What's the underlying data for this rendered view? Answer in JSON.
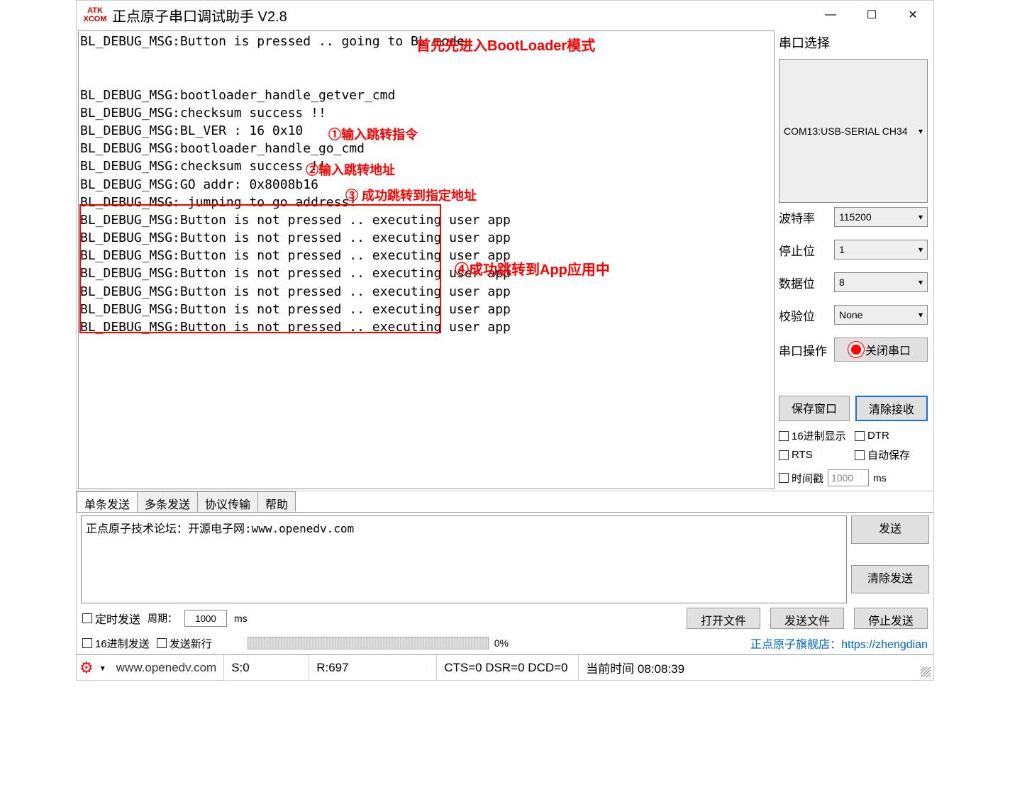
{
  "title": "正点原子串口调试助手 V2.8",
  "rx_lines": [
    "BL_DEBUG_MSG:Button is pressed .. going to BL mode",
    "",
    "",
    "BL_DEBUG_MSG:bootloader_handle_getver_cmd",
    "BL_DEBUG_MSG:checksum success !!",
    "BL_DEBUG_MSG:BL_VER : 16 0x10",
    "BL_DEBUG_MSG:bootloader_handle_go_cmd",
    "BL_DEBUG_MSG:checksum success !!",
    "BL_DEBUG_MSG:GO addr: 0x8008b16",
    "BL_DEBUG_MSG: jumping to go address!",
    "BL_DEBUG_MSG:Button is not pressed .. executing user app",
    "BL_DEBUG_MSG:Button is not pressed .. executing user app",
    "BL_DEBUG_MSG:Button is not pressed .. executing user app",
    "BL_DEBUG_MSG:Button is not pressed .. executing user app",
    "BL_DEBUG_MSG:Button is not pressed .. executing user app",
    "BL_DEBUG_MSG:Button is not pressed .. executing user app",
    "BL_DEBUG_MSG:Button is not pressed .. executing user app"
  ],
  "annotations": {
    "a1": "首先先进入BootLoader模式",
    "a2": "①输入跳转指令",
    "a3": "②输入跳转地址",
    "a4": "③ 成功跳转到指定地址",
    "a5": "④成功跳转到App应用中"
  },
  "right": {
    "header": "串口选择",
    "port": "COM13:USB-SERIAL CH34",
    "baud_label": "波特率",
    "baud": "115200",
    "stop_label": "停止位",
    "stop": "1",
    "data_label": "数据位",
    "data": "8",
    "parity_label": "校验位",
    "parity": "None",
    "op_label": "串口操作",
    "close_port": "关闭串口",
    "save_window": "保存窗口",
    "clear_rx": "清除接收",
    "hex_display": "16进制显示",
    "dtr": "DTR",
    "rts": "RTS",
    "auto_save": "自动保存",
    "timestamp": "时间戳",
    "ts_value": "1000",
    "ts_unit": "ms"
  },
  "tabs": {
    "single": "单条发送",
    "multi": "多条发送",
    "protocol": "协议传输",
    "help": "帮助"
  },
  "tx_text": "正点原子技术论坛：开源电子网:www.openedv.com",
  "tx_buttons": {
    "send": "发送",
    "clear": "清除发送"
  },
  "send_row1": {
    "timed_send": "定时发送",
    "period_label": "周期：",
    "period_value": "1000",
    "period_unit": "ms",
    "open_file": "打开文件",
    "send_file": "发送文件",
    "stop_send": "停止发送"
  },
  "send_row2": {
    "hex_send": "16进制发送",
    "send_newline": "发送新行",
    "progress": "0%",
    "shop_text": "正点原子旗舰店：https://zhengdian"
  },
  "status": {
    "url": "www.openedv.com",
    "s": "S:0",
    "r": "R:697",
    "cts": "CTS=0 DSR=0 DCD=0",
    "time": "当前时间 08:08:39"
  }
}
